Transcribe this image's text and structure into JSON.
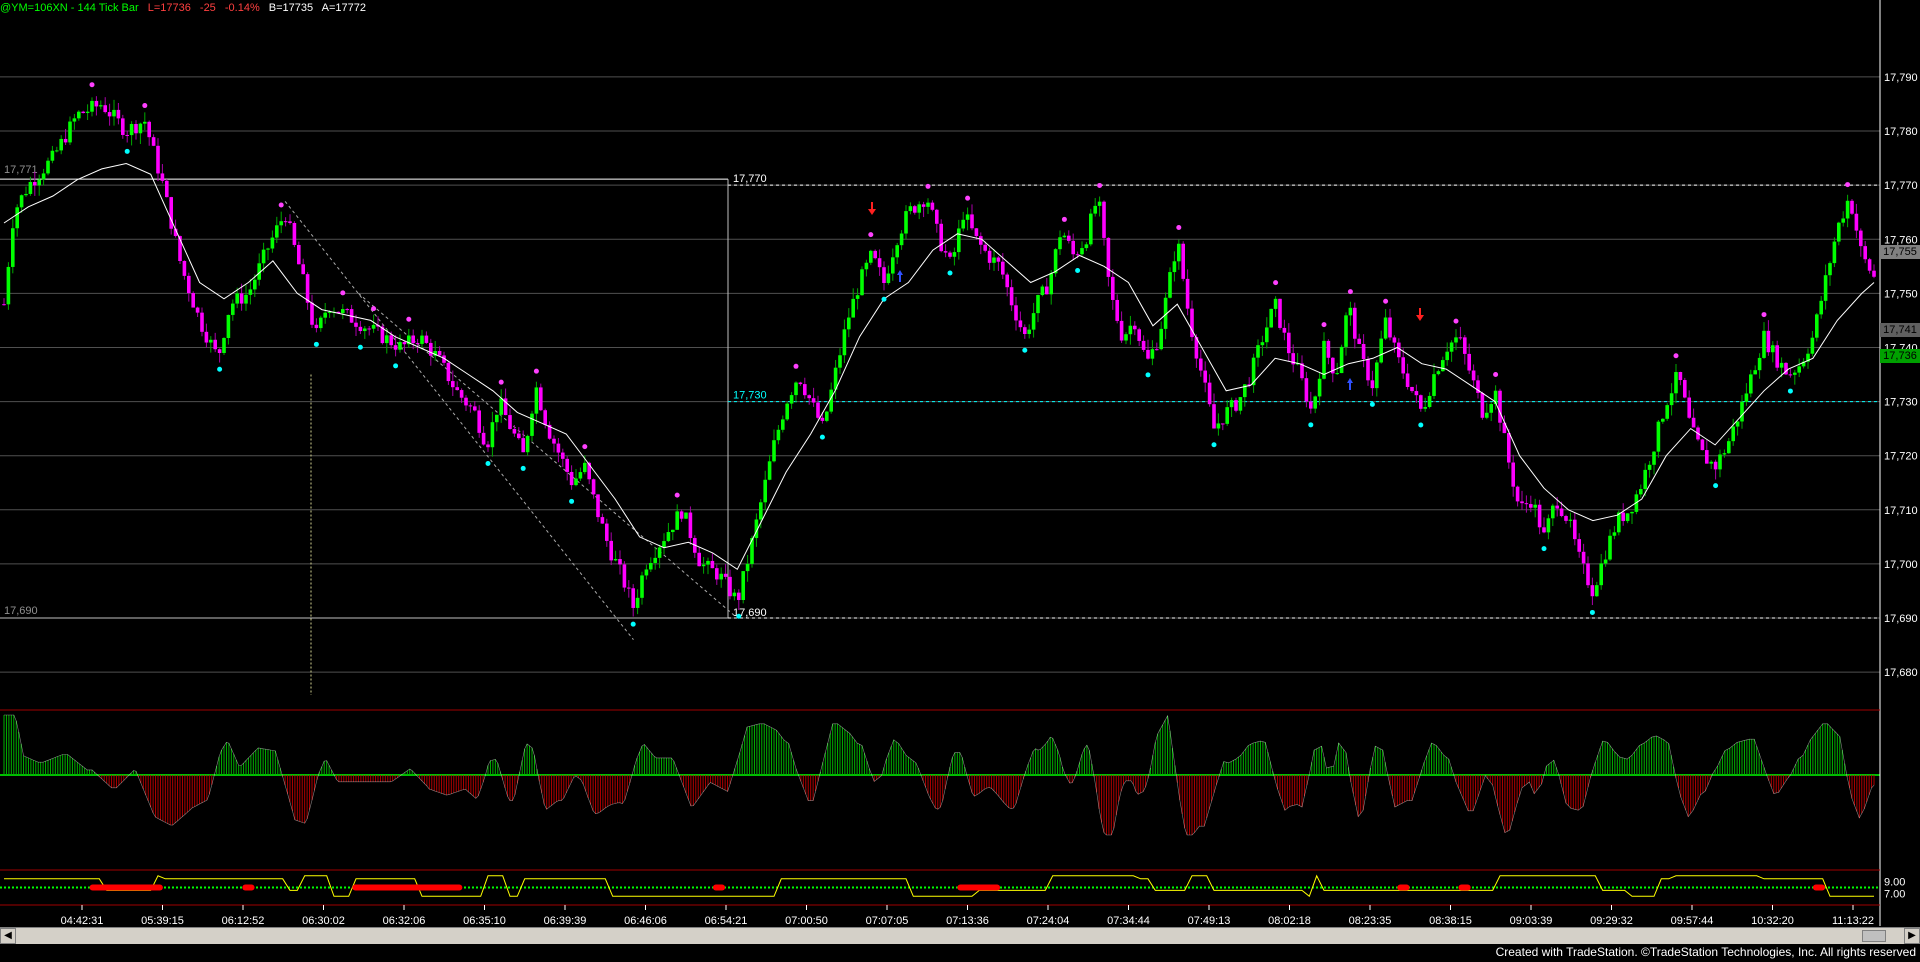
{
  "header": {
    "symbol": "@YM=106XN - 144 Tick Bar",
    "last": "L=17736",
    "change": "-25",
    "change_pct": "-0.14%",
    "bid": "B=17735",
    "ask": "A=17772"
  },
  "footer": {
    "text": "Created with TradeStation. ©TradeStation Technologies, Inc. All rights reserved"
  },
  "price_tags": {
    "t1": "17,755",
    "t2": "17,741",
    "t3": "17,736"
  },
  "levels": {
    "l1_right": "17,770",
    "l1_left": "17,771",
    "l2": "17,730",
    "l3_left": "17,690",
    "l3_right": "17,690"
  },
  "colors": {
    "up": "#00ff00",
    "down": "#ff00ff",
    "osc_up": "#00cc00",
    "osc_down": "#cc0000",
    "ma": "#ffffff",
    "cyan": "#00ffff",
    "yellow": "#ffff00"
  },
  "chart_data": [
    {
      "type": "candlestick",
      "y_ticks": [
        "17,790",
        "17,780",
        "17,770",
        "17,760",
        "17,750",
        "17,740",
        "17,730",
        "17,720",
        "17,710",
        "17,700",
        "17,690",
        "17,680"
      ],
      "ylim": [
        17673,
        17802
      ],
      "grid": true,
      "x_ticks": [
        "04:42:31",
        "05:39:15",
        "06:12:52",
        "06:30:02",
        "06:32:06",
        "06:35:10",
        "06:39:39",
        "06:46:06",
        "06:54:21",
        "07:00:50",
        "07:07:05",
        "07:13:36",
        "07:24:04",
        "07:34:44",
        "07:49:13",
        "08:02:18",
        "08:23:35",
        "08:38:15",
        "09:03:39",
        "09:29:32",
        "09:57:44",
        "10:32:20",
        "11:13:22"
      ],
      "price_path": [
        [
          0,
          17748
        ],
        [
          8,
          17765
        ],
        [
          20,
          17770
        ],
        [
          40,
          17775
        ],
        [
          60,
          17783
        ],
        [
          80,
          17785
        ],
        [
          100,
          17780
        ],
        [
          115,
          17782
        ],
        [
          130,
          17770
        ],
        [
          145,
          17755
        ],
        [
          160,
          17745
        ],
        [
          175,
          17738
        ],
        [
          185,
          17748
        ],
        [
          200,
          17750
        ],
        [
          215,
          17758
        ],
        [
          230,
          17765
        ],
        [
          245,
          17752
        ],
        [
          255,
          17742
        ],
        [
          265,
          17748
        ],
        [
          280,
          17746
        ],
        [
          295,
          17744
        ],
        [
          310,
          17742
        ],
        [
          325,
          17740
        ],
        [
          340,
          17742
        ],
        [
          355,
          17738
        ],
        [
          370,
          17732
        ],
        [
          385,
          17728
        ],
        [
          395,
          17722
        ],
        [
          405,
          17730
        ],
        [
          415,
          17725
        ],
        [
          425,
          17720
        ],
        [
          435,
          17733
        ],
        [
          445,
          17725
        ],
        [
          455,
          17720
        ],
        [
          465,
          17715
        ],
        [
          475,
          17718
        ],
        [
          485,
          17710
        ],
        [
          495,
          17703
        ],
        [
          505,
          17698
        ],
        [
          515,
          17692
        ],
        [
          525,
          17700
        ],
        [
          540,
          17705
        ],
        [
          555,
          17710
        ],
        [
          570,
          17700
        ],
        [
          585,
          17698
        ],
        [
          600,
          17693
        ],
        [
          610,
          17702
        ],
        [
          620,
          17712
        ],
        [
          630,
          17722
        ],
        [
          640,
          17730
        ],
        [
          650,
          17735
        ],
        [
          660,
          17730
        ],
        [
          670,
          17725
        ],
        [
          680,
          17735
        ],
        [
          690,
          17745
        ],
        [
          700,
          17752
        ],
        [
          710,
          17757
        ],
        [
          720,
          17752
        ],
        [
          730,
          17760
        ],
        [
          740,
          17765
        ],
        [
          755,
          17768
        ],
        [
          765,
          17760
        ],
        [
          775,
          17755
        ],
        [
          785,
          17765
        ],
        [
          795,
          17760
        ],
        [
          805,
          17757
        ],
        [
          815,
          17755
        ],
        [
          825,
          17748
        ],
        [
          835,
          17742
        ],
        [
          845,
          17748
        ],
        [
          855,
          17752
        ],
        [
          865,
          17762
        ],
        [
          875,
          17757
        ],
        [
          885,
          17760
        ],
        [
          895,
          17768
        ],
        [
          905,
          17750
        ],
        [
          915,
          17742
        ],
        [
          925,
          17745
        ],
        [
          935,
          17737
        ],
        [
          945,
          17742
        ],
        [
          960,
          17760
        ],
        [
          970,
          17745
        ],
        [
          980,
          17735
        ],
        [
          990,
          17725
        ],
        [
          1000,
          17728
        ],
        [
          1010,
          17730
        ],
        [
          1020,
          17735
        ],
        [
          1030,
          17742
        ],
        [
          1040,
          17748
        ],
        [
          1050,
          17740
        ],
        [
          1060,
          17735
        ],
        [
          1070,
          17728
        ],
        [
          1080,
          17740
        ],
        [
          1090,
          17735
        ],
        [
          1100,
          17748
        ],
        [
          1110,
          17738
        ],
        [
          1120,
          17733
        ],
        [
          1130,
          17745
        ],
        [
          1140,
          17738
        ],
        [
          1150,
          17733
        ],
        [
          1160,
          17728
        ],
        [
          1170,
          17735
        ],
        [
          1180,
          17740
        ],
        [
          1190,
          17742
        ],
        [
          1200,
          17735
        ],
        [
          1210,
          17728
        ],
        [
          1220,
          17732
        ],
        [
          1230,
          17720
        ],
        [
          1240,
          17710
        ],
        [
          1250,
          17712
        ],
        [
          1260,
          17705
        ],
        [
          1270,
          17712
        ],
        [
          1280,
          17708
        ],
        [
          1290,
          17700
        ],
        [
          1300,
          17695
        ],
        [
          1310,
          17702
        ],
        [
          1320,
          17708
        ],
        [
          1330,
          17710
        ],
        [
          1340,
          17715
        ],
        [
          1350,
          17722
        ],
        [
          1360,
          17730
        ],
        [
          1370,
          17735
        ],
        [
          1380,
          17725
        ],
        [
          1390,
          17720
        ],
        [
          1400,
          17718
        ],
        [
          1410,
          17722
        ],
        [
          1420,
          17728
        ],
        [
          1430,
          17735
        ],
        [
          1440,
          17742
        ],
        [
          1450,
          17738
        ],
        [
          1460,
          17735
        ],
        [
          1470,
          17737
        ],
        [
          1480,
          17742
        ],
        [
          1490,
          17752
        ],
        [
          1500,
          17762
        ],
        [
          1510,
          17768
        ],
        [
          1520,
          17757
        ],
        [
          1530,
          17753
        ]
      ],
      "ma_path": [
        [
          0,
          17763
        ],
        [
          20,
          17766
        ],
        [
          40,
          17768
        ],
        [
          60,
          17771
        ],
        [
          80,
          17773
        ],
        [
          100,
          17774
        ],
        [
          120,
          17772
        ],
        [
          140,
          17762
        ],
        [
          160,
          17752
        ],
        [
          180,
          17749
        ],
        [
          200,
          17752
        ],
        [
          220,
          17756
        ],
        [
          240,
          17750
        ],
        [
          260,
          17747
        ],
        [
          280,
          17746
        ],
        [
          300,
          17745
        ],
        [
          320,
          17742
        ],
        [
          340,
          17740
        ],
        [
          360,
          17738
        ],
        [
          380,
          17735
        ],
        [
          400,
          17732
        ],
        [
          420,
          17728
        ],
        [
          440,
          17726
        ],
        [
          460,
          17724
        ],
        [
          480,
          17718
        ],
        [
          500,
          17712
        ],
        [
          520,
          17705
        ],
        [
          540,
          17703
        ],
        [
          560,
          17704
        ],
        [
          580,
          17702
        ],
        [
          600,
          17699
        ],
        [
          620,
          17708
        ],
        [
          640,
          17717
        ],
        [
          660,
          17724
        ],
        [
          680,
          17732
        ],
        [
          700,
          17742
        ],
        [
          720,
          17749
        ],
        [
          740,
          17752
        ],
        [
          760,
          17758
        ],
        [
          780,
          17761
        ],
        [
          800,
          17760
        ],
        [
          820,
          17756
        ],
        [
          840,
          17752
        ],
        [
          860,
          17754
        ],
        [
          880,
          17757
        ],
        [
          900,
          17755
        ],
        [
          920,
          17752
        ],
        [
          940,
          17744
        ],
        [
          960,
          17748
        ],
        [
          980,
          17740
        ],
        [
          1000,
          17732
        ],
        [
          1020,
          17733
        ],
        [
          1040,
          17738
        ],
        [
          1060,
          17737
        ],
        [
          1080,
          17735
        ],
        [
          1100,
          17737
        ],
        [
          1120,
          17738
        ],
        [
          1140,
          17740
        ],
        [
          1160,
          17737
        ],
        [
          1180,
          17736
        ],
        [
          1200,
          17733
        ],
        [
          1220,
          17730
        ],
        [
          1240,
          17720
        ],
        [
          1260,
          17714
        ],
        [
          1280,
          17710
        ],
        [
          1300,
          17708
        ],
        [
          1320,
          17709
        ],
        [
          1340,
          17712
        ],
        [
          1360,
          17720
        ],
        [
          1380,
          17725
        ],
        [
          1400,
          17722
        ],
        [
          1420,
          17727
        ],
        [
          1440,
          17732
        ],
        [
          1460,
          17736
        ],
        [
          1480,
          17738
        ],
        [
          1500,
          17745
        ],
        [
          1520,
          17750
        ],
        [
          1530,
          17752
        ]
      ],
      "reference_lines": [
        17770,
        17730,
        17690
      ]
    },
    {
      "type": "histogram",
      "zero_line": true,
      "color_up": "#00cc00",
      "color_down": "#cc0000"
    },
    {
      "type": "line",
      "y_ticks": [
        "9.00",
        "7.00"
      ],
      "ylim": [
        5,
        11
      ]
    }
  ]
}
